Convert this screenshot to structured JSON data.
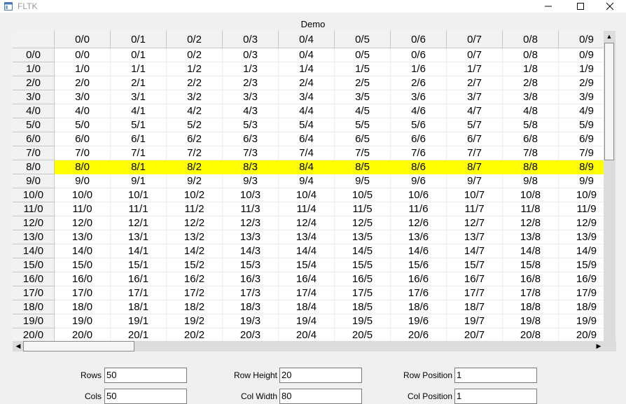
{
  "window": {
    "title": "FLTK"
  },
  "table": {
    "caption": "Demo",
    "highlight_row": "8/0",
    "highlight_color": "#ffff00",
    "columns": [
      "0/0",
      "0/1",
      "0/2",
      "0/3",
      "0/4",
      "0/5",
      "0/6",
      "0/7",
      "0/8",
      "0/9"
    ],
    "rows": [
      {
        "header": "0/0",
        "cells": [
          "0/0",
          "0/1",
          "0/2",
          "0/3",
          "0/4",
          "0/5",
          "0/6",
          "0/7",
          "0/8",
          "0/9"
        ]
      },
      {
        "header": "1/0",
        "cells": [
          "1/0",
          "1/1",
          "1/2",
          "1/3",
          "1/4",
          "1/5",
          "1/6",
          "1/7",
          "1/8",
          "1/9"
        ]
      },
      {
        "header": "2/0",
        "cells": [
          "2/0",
          "2/1",
          "2/2",
          "2/3",
          "2/4",
          "2/5",
          "2/6",
          "2/7",
          "2/8",
          "2/9"
        ]
      },
      {
        "header": "3/0",
        "cells": [
          "3/0",
          "3/1",
          "3/2",
          "3/3",
          "3/4",
          "3/5",
          "3/6",
          "3/7",
          "3/8",
          "3/9"
        ]
      },
      {
        "header": "4/0",
        "cells": [
          "4/0",
          "4/1",
          "4/2",
          "4/3",
          "4/4",
          "4/5",
          "4/6",
          "4/7",
          "4/8",
          "4/9"
        ]
      },
      {
        "header": "5/0",
        "cells": [
          "5/0",
          "5/1",
          "5/2",
          "5/3",
          "5/4",
          "5/5",
          "5/6",
          "5/7",
          "5/8",
          "5/9"
        ]
      },
      {
        "header": "6/0",
        "cells": [
          "6/0",
          "6/1",
          "6/2",
          "6/3",
          "6/4",
          "6/5",
          "6/6",
          "6/7",
          "6/8",
          "6/9"
        ]
      },
      {
        "header": "7/0",
        "cells": [
          "7/0",
          "7/1",
          "7/2",
          "7/3",
          "7/4",
          "7/5",
          "7/6",
          "7/7",
          "7/8",
          "7/9"
        ]
      },
      {
        "header": "8/0",
        "cells": [
          "8/0",
          "8/1",
          "8/2",
          "8/3",
          "8/4",
          "8/5",
          "8/6",
          "8/7",
          "8/8",
          "8/9"
        ]
      },
      {
        "header": "9/0",
        "cells": [
          "9/0",
          "9/1",
          "9/2",
          "9/3",
          "9/4",
          "9/5",
          "9/6",
          "9/7",
          "9/8",
          "9/9"
        ]
      },
      {
        "header": "10/0",
        "cells": [
          "10/0",
          "10/1",
          "10/2",
          "10/3",
          "10/4",
          "10/5",
          "10/6",
          "10/7",
          "10/8",
          "10/9"
        ]
      },
      {
        "header": "11/0",
        "cells": [
          "11/0",
          "11/1",
          "11/2",
          "11/3",
          "11/4",
          "11/5",
          "11/6",
          "11/7",
          "11/8",
          "11/9"
        ]
      },
      {
        "header": "12/0",
        "cells": [
          "12/0",
          "12/1",
          "12/2",
          "12/3",
          "12/4",
          "12/5",
          "12/6",
          "12/7",
          "12/8",
          "12/9"
        ]
      },
      {
        "header": "13/0",
        "cells": [
          "13/0",
          "13/1",
          "13/2",
          "13/3",
          "13/4",
          "13/5",
          "13/6",
          "13/7",
          "13/8",
          "13/9"
        ]
      },
      {
        "header": "14/0",
        "cells": [
          "14/0",
          "14/1",
          "14/2",
          "14/3",
          "14/4",
          "14/5",
          "14/6",
          "14/7",
          "14/8",
          "14/9"
        ]
      },
      {
        "header": "15/0",
        "cells": [
          "15/0",
          "15/1",
          "15/2",
          "15/3",
          "15/4",
          "15/5",
          "15/6",
          "15/7",
          "15/8",
          "15/9"
        ]
      },
      {
        "header": "16/0",
        "cells": [
          "16/0",
          "16/1",
          "16/2",
          "16/3",
          "16/4",
          "16/5",
          "16/6",
          "16/7",
          "16/8",
          "16/9"
        ]
      },
      {
        "header": "17/0",
        "cells": [
          "17/0",
          "17/1",
          "17/2",
          "17/3",
          "17/4",
          "17/5",
          "17/6",
          "17/7",
          "17/8",
          "17/9"
        ]
      },
      {
        "header": "18/0",
        "cells": [
          "18/0",
          "18/1",
          "18/2",
          "18/3",
          "18/4",
          "18/5",
          "18/6",
          "18/7",
          "18/8",
          "18/9"
        ]
      },
      {
        "header": "19/0",
        "cells": [
          "19/0",
          "19/1",
          "19/2",
          "19/3",
          "19/4",
          "19/5",
          "19/6",
          "19/7",
          "19/8",
          "19/9"
        ]
      },
      {
        "header": "20/0",
        "cells": [
          "20/0",
          "20/1",
          "20/2",
          "20/3",
          "20/4",
          "20/5",
          "20/6",
          "20/7",
          "20/8",
          "20/9"
        ]
      }
    ]
  },
  "controls": {
    "rows": {
      "label": "Rows",
      "value": "50"
    },
    "cols": {
      "label": "Cols",
      "value": "50"
    },
    "row_height": {
      "label": "Row Height",
      "value": "20"
    },
    "col_width": {
      "label": "Col Width",
      "value": "80"
    },
    "row_position": {
      "label": "Row Position",
      "value": "1"
    },
    "col_position": {
      "label": "Col Position",
      "value": "1"
    }
  }
}
